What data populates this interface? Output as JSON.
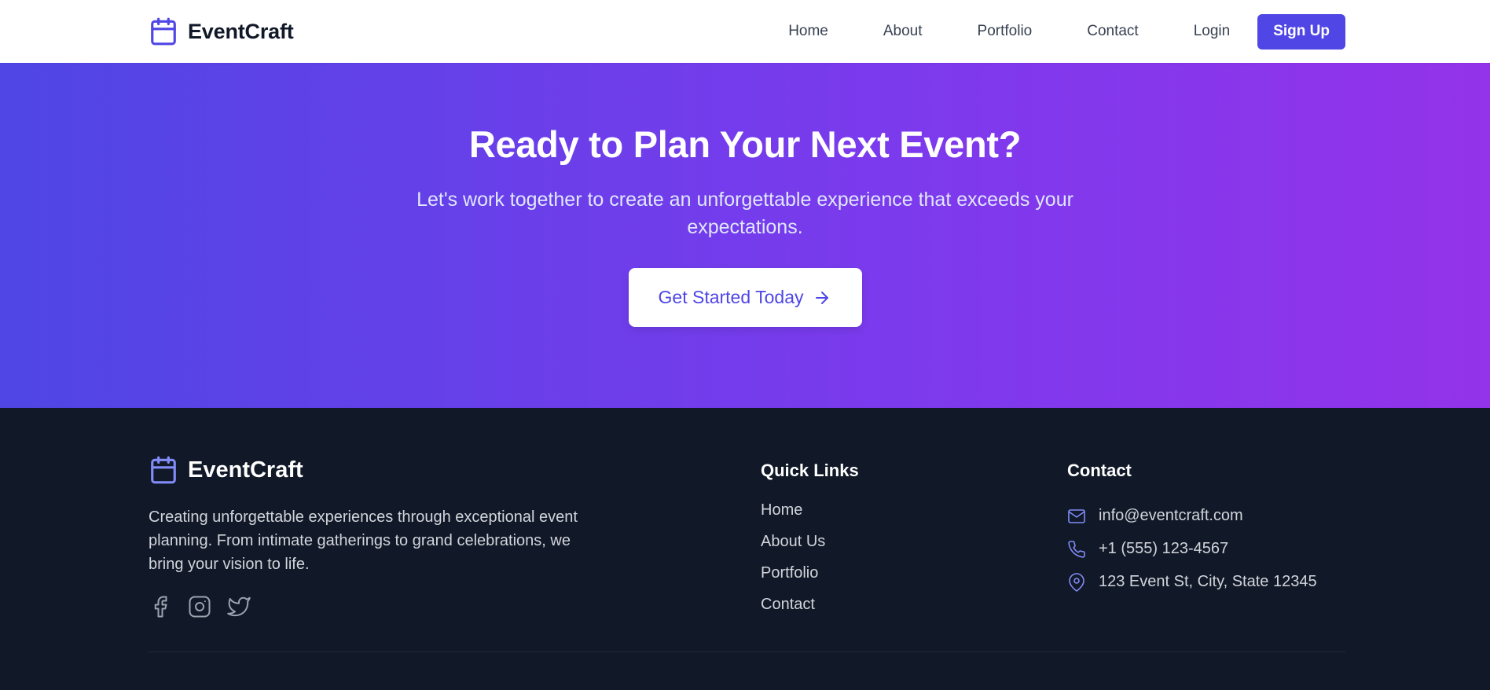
{
  "nav": {
    "brand": "EventCraft",
    "links": [
      "Home",
      "About",
      "Portfolio",
      "Contact"
    ],
    "login": "Login",
    "signup": "Sign Up"
  },
  "hero": {
    "title": "Ready to Plan Your Next Event?",
    "subtitle": "Let's work together to create an unforgettable experience that exceeds your expectations.",
    "cta": "Get Started Today"
  },
  "footer": {
    "brand": "EventCraft",
    "description": "Creating unforgettable experiences through exceptional event planning. From intimate gatherings to grand celebrations, we bring your vision to life.",
    "quick_links_title": "Quick Links",
    "quick_links": [
      "Home",
      "About Us",
      "Portfolio",
      "Contact"
    ],
    "contact_title": "Contact",
    "email": "info@eventcraft.com",
    "phone": "+1 (555) 123-4567",
    "address": "123 Event St, City, State 12345"
  },
  "colors": {
    "accent": "#4f46e5",
    "gradient_end": "#9333ea",
    "footer_bg": "#111827",
    "footer_icon": "#818cf8"
  },
  "icons": [
    "calendar-icon",
    "arrow-right-icon",
    "facebook-icon",
    "instagram-icon",
    "twitter-icon",
    "mail-icon",
    "phone-icon",
    "map-pin-icon"
  ]
}
